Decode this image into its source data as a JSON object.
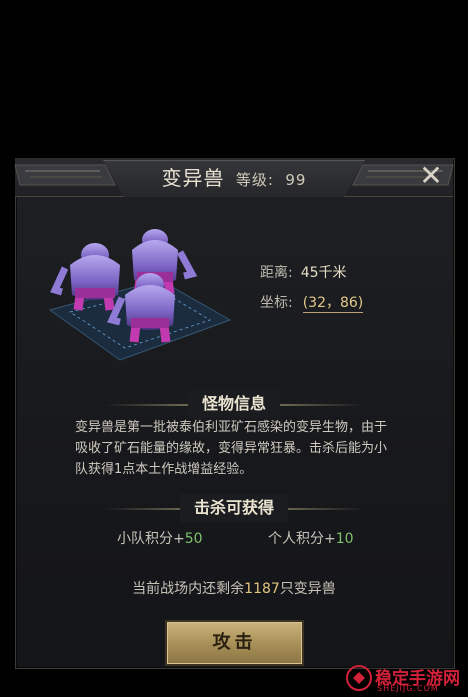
{
  "dialog": {
    "title": "变异兽",
    "level_label": "等级:",
    "level_value": "99"
  },
  "info": {
    "distance_label": "距离:",
    "distance_value": "45千米",
    "coord_label": "坐标:",
    "coord_value": "(32，86)"
  },
  "monster_section": {
    "heading": "怪物信息",
    "description": "变异兽是第一批被泰伯利亚矿石感染的变异生物，由于吸收了矿石能量的缘故，变得异常狂暴。击杀后能为小队获得1点本土作战增益经验。"
  },
  "rewards": {
    "heading": "击杀可获得",
    "team_label": "小队积分+",
    "team_value": "50",
    "personal_label": "个人积分+",
    "personal_value": "10"
  },
  "remain": {
    "prefix": "当前战场内还剩余",
    "count": "1187",
    "suffix": "只变异兽"
  },
  "attack_button": {
    "label": "攻击"
  },
  "watermark": {
    "text": "稳定手游网",
    "sub": "SHEJIJG.COM"
  },
  "colors": {
    "accent_gold": "#e2c57f",
    "green": "#7fc26b",
    "button": "#a68e57"
  }
}
